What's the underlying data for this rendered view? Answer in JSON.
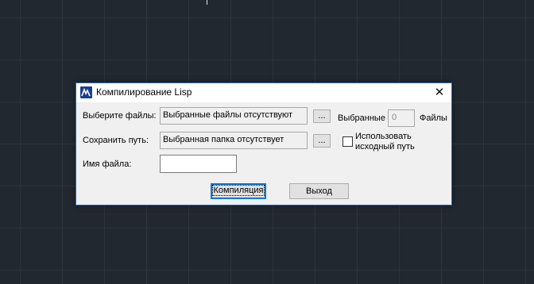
{
  "dialog": {
    "title": "Компилирование Lisp",
    "close_glyph": "✕",
    "select_files_label": "Выберите файлы:",
    "selected_files_value": "Выбранные файлы отсутствуют",
    "browse_files_label": "...",
    "selected_label": "Выбранные",
    "selected_count": "0",
    "files_label": "Файлы",
    "save_path_label": "Сохранить путь:",
    "save_path_value": "Выбранная папка отсутствует",
    "browse_path_label": "...",
    "use_source_line1": "Использовать",
    "use_source_line2": "исходный путь",
    "use_source_checked": false,
    "filename_label": "Имя файла:",
    "filename_value": "",
    "compile_button": "Компиляция",
    "exit_button": "Выход"
  },
  "colors": {
    "canvas_background": "#212830",
    "dialog_background": "#f0f0f0",
    "accent": "#0078d7"
  },
  "icons": {
    "app": "lisp-app-icon",
    "close": "close-icon"
  }
}
